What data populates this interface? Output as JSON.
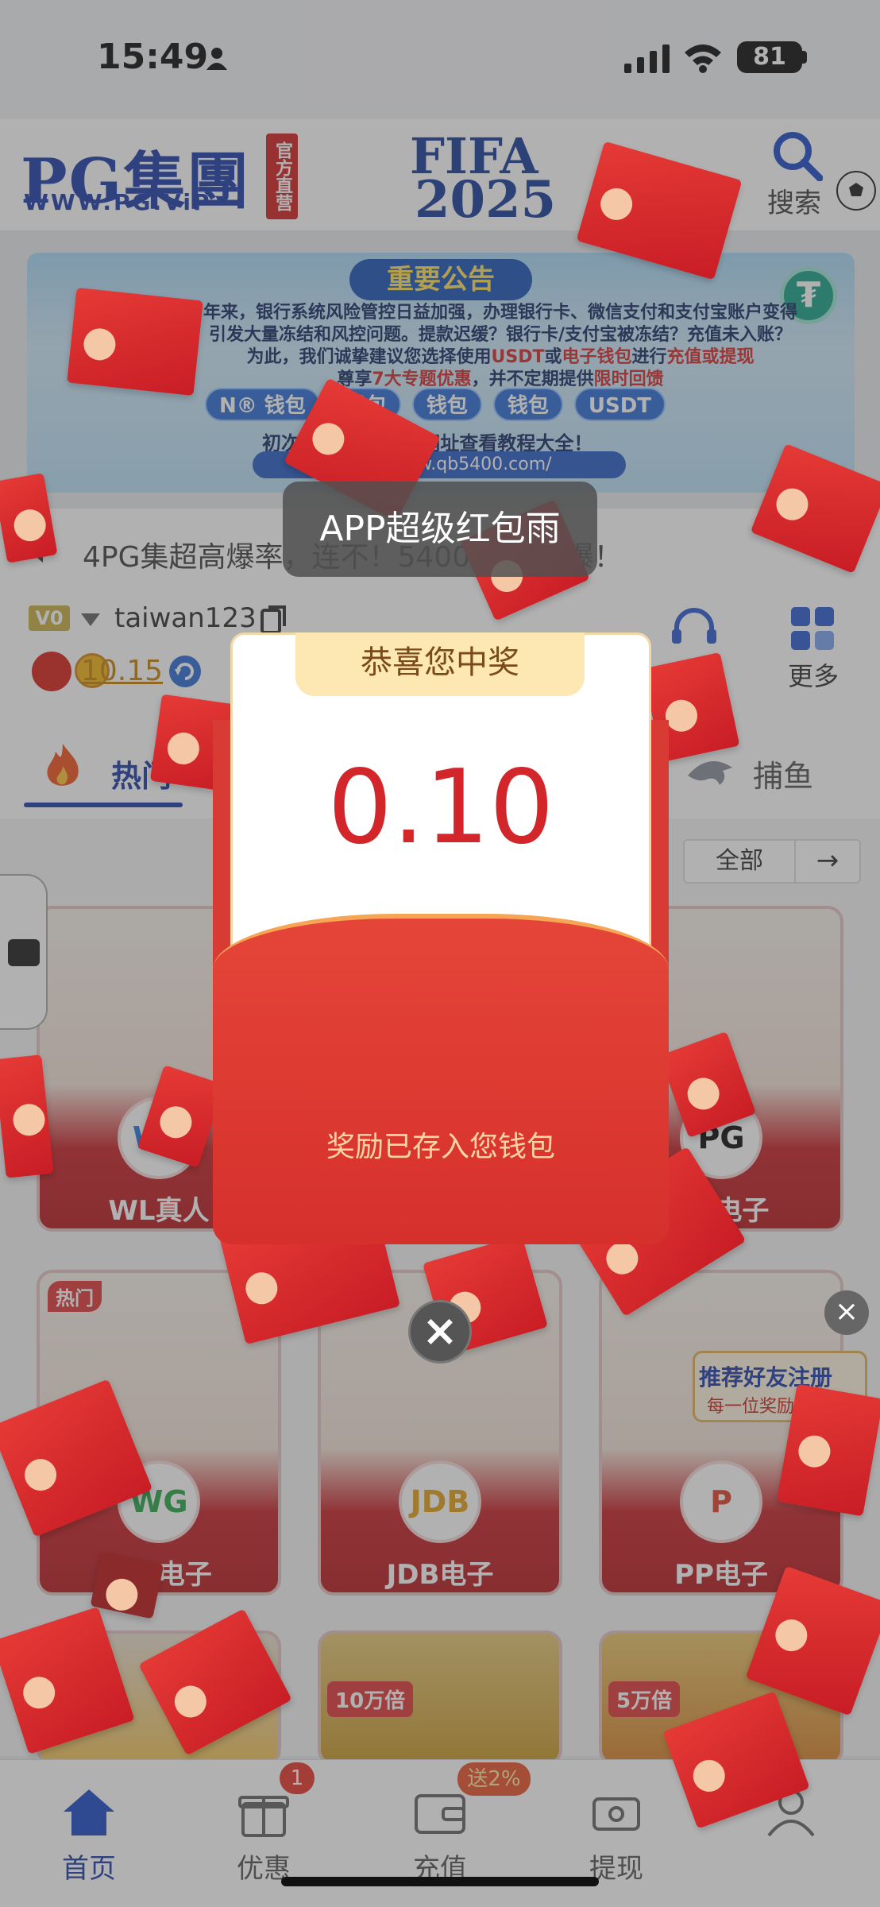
{
  "status_bar": {
    "time": "15:49",
    "battery": "81"
  },
  "header": {
    "logo_main": "PG集團",
    "logo_sub": "WWW.PG.ViP",
    "logo_badge": "官方直营",
    "event_title": "FIFA",
    "event_year": "2025",
    "search_label": "搜索"
  },
  "banner": {
    "title": "重要公告",
    "line1": "年来，银行系统风险管控日益加强，办理银行卡、微信支付和支付宝账户变得",
    "line2": "引发大量冻结和风控问题。提款迟缓？银行卡/支付宝被冻结？充值未入账？",
    "line3_a": "为此，我们诚挚建议您选择使用",
    "line3_usdt": "USDT",
    "line3_or": "或",
    "line3_wallet": "电子钱包",
    "line3_b": "进行",
    "line3_action": "充值或提现",
    "line4_a": "尊享",
    "line4_hl": "7大专题优惠",
    "line4_b": "，并不定期提供",
    "line4_hl2": "限时回馈",
    "pills": [
      "N® 钱包",
      "钱包",
      "钱包",
      "钱包",
      "USDT"
    ],
    "help": "初次                包？输入以下网址查看教程大全！",
    "url": "https://www.qb5400.com/"
  },
  "marquee": {
    "text": "4PG集超高爆率，连不！5400    ，进，爆！"
  },
  "user": {
    "vip": "V0",
    "username": "taiwan123",
    "balance": "10.15",
    "service_label": "客服",
    "more_label": "更多"
  },
  "tabs": {
    "hot_label": "热门",
    "fish_label": "捕鱼"
  },
  "filter": {
    "all_label": "全部",
    "next_icon": "→"
  },
  "cards": [
    {
      "name": "WL真人",
      "logo": "WL",
      "tag": ""
    },
    {
      "name": "PG电子",
      "logo": "PG",
      "tag": ""
    },
    {
      "name": "WG电子",
      "logo": "WG",
      "tag": "热门"
    },
    {
      "name": "JDB电子",
      "logo": "JDB",
      "tag": ""
    },
    {
      "name": "PP电子",
      "logo": "P",
      "tag": ""
    },
    {
      "name": "",
      "logo": "",
      "tag": "",
      "thumb_tag": ""
    },
    {
      "name": "",
      "logo": "",
      "tag": "",
      "thumb_tag": "10万倍"
    },
    {
      "name": "",
      "logo": "",
      "tag": "",
      "thumb_tag": "5万倍"
    }
  ],
  "popup": {
    "toast": "APP超级红包雨",
    "ribbon": "恭喜您中奖",
    "amount": "0.10",
    "message": "奖励已存入您钱包",
    "close_icon": "×"
  },
  "ad": {
    "title": "推荐好友注册",
    "sub": "每一位奖励150元",
    "close_icon": "×"
  },
  "bottom_nav": {
    "items": [
      {
        "label": "首页"
      },
      {
        "label": "优惠"
      },
      {
        "label": "充值"
      },
      {
        "label": "提现"
      },
      {
        "label": ""
      }
    ],
    "promo_badge": "1",
    "recharge_badge": "送2%"
  },
  "colors": {
    "brand_blue": "#1f3fa8",
    "envelope_red": "#d83a34",
    "amount_red": "#d3262a"
  }
}
